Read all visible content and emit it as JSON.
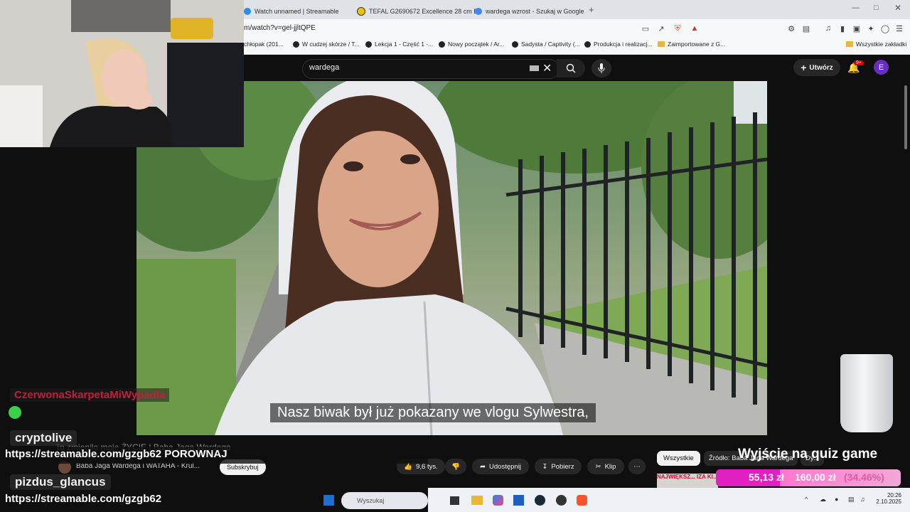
{
  "browser": {
    "tabs": [
      {
        "label": "Watch unnamed | Streamable",
        "color": "#2a8be8"
      },
      {
        "label": "TEFAL G2690672 Excellence 28 cm Bı",
        "color": "#f2c200"
      },
      {
        "label": "wardega wzrost - Szukaj w Google",
        "color": "#4285f4"
      }
    ],
    "url": "m/watch?v=gel-jjltQPE",
    "bookmarks": [
      "chłopak (201...",
      "W cudzej skórze / T...",
      "Lekcja 1 - Część 1 -...",
      "Nowy początek / Ar...",
      "Sadysta / Captivity (...",
      "Produkcja i realizacj...",
      "Zaimportowane z G..."
    ],
    "all_bookmarks": "Wszystkie zakładki"
  },
  "youtube": {
    "search_value": "wardega",
    "create_label": "Utwórz",
    "notif_badge": "9+",
    "avatar_letter": "E",
    "subtitle": "Nasz biwak był już pokazany we vlogu Sylwestra,",
    "video_title": "To zmieniło moje ŻYCIE | Baba Jaga Wardega",
    "channel": "Baba Jaga Wardega i WATAHA - Krul...",
    "subscribe": "Subskrybuj",
    "likes": "9,6 tys.",
    "share": "Udostępnij",
    "download": "Pobierz",
    "clip": "Klip",
    "chips": [
      "Wszystkie",
      "Źródło: Baba Jaga Wardega",
      "Dy..."
    ],
    "rec_thumb_text": "NAJWIĘKSZ... IZA KI..."
  },
  "chat": {
    "msg1_name": "CzerwonaSkarpetaMiWypadla",
    "msg2_name": "cryptolive",
    "msg2_text": "https://streamable.com/gzgb62 POROWNAJ",
    "msg3_name": "pizdus_glancus",
    "msg3_text": "https://streamable.com/gzgb62"
  },
  "overlay": {
    "quiz_text": "Wyjście na quiz game",
    "goal_current": "55,13 zł",
    "goal_target": "160,00 zł",
    "goal_percent": "(34.46%)",
    "goal_fraction": 0.3446
  },
  "taskbar": {
    "search_placeholder": "Wyszukaj",
    "time": "20:26",
    "date": "2.10.2025"
  }
}
